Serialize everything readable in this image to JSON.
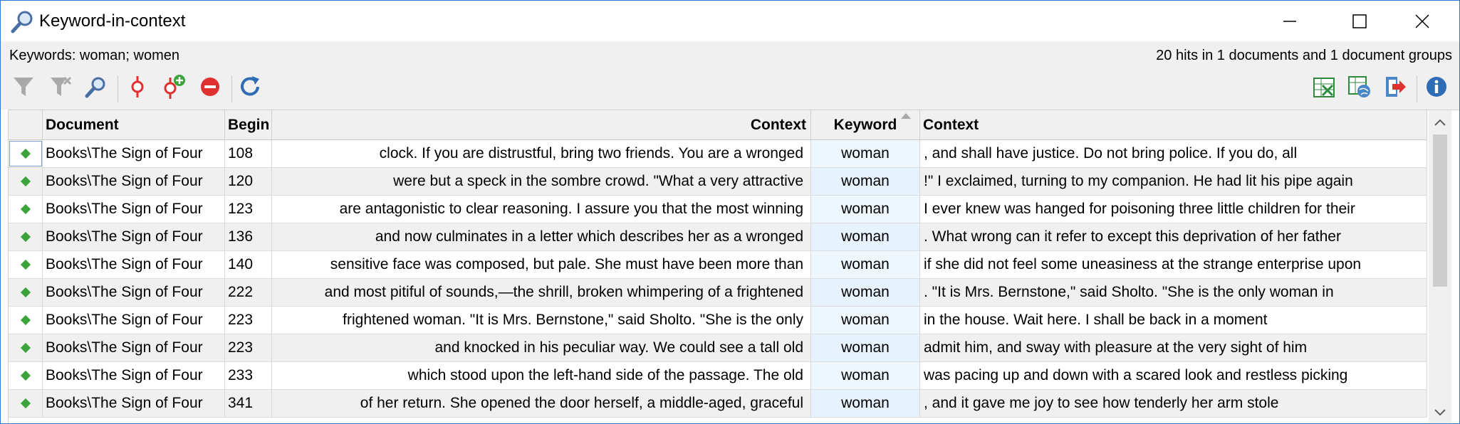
{
  "window": {
    "title": "Keyword-in-context",
    "icon": "magnifier-icon"
  },
  "info": {
    "keywords": "Keywords: woman; women",
    "hits": "20 hits in 1 documents and 1 document groups"
  },
  "toolbar": {
    "left_icons": [
      "filter-icon",
      "clear-filter-icon",
      "search-icon",
      "code-icon",
      "add-code-icon",
      "remove-code-icon",
      "refresh-icon"
    ],
    "right_icons": [
      "excel-export-icon",
      "web-export-icon",
      "export-icon",
      "info-icon"
    ]
  },
  "colors": {
    "accent": "#2b79d6",
    "indicator": "#3aa33a",
    "keyword_bg": "#e6f2fd",
    "code_red": "#e03030"
  },
  "table": {
    "headers": {
      "document": "Document",
      "begin": "Begin",
      "context_left": "Context",
      "keyword": "Keyword",
      "context_right": "Context"
    },
    "sort": {
      "column": "Keyword",
      "direction": "ascending"
    },
    "rows": [
      {
        "document": "Books\\The Sign of Four",
        "begin": "108",
        "left": "clock. If you are distrustful, bring two friends. You are a wronged",
        "keyword": "woman",
        "right": ", and shall have justice. Do not bring police. If you do, all"
      },
      {
        "document": "Books\\The Sign of Four",
        "begin": "120",
        "left": "were but a speck in the sombre crowd.  \"What a very attractive",
        "keyword": "woman",
        "right": "!\" I exclaimed, turning to my companion.  He had lit his pipe again"
      },
      {
        "document": "Books\\The Sign of Four",
        "begin": "123",
        "left": "are antagonistic to clear reasoning. I assure you that the most winning",
        "keyword": "woman",
        "right": " I ever knew was hanged for poisoning three little children for their"
      },
      {
        "document": "Books\\The Sign of Four",
        "begin": "136",
        "left": "and now culminates in a letter which describes her as a wronged",
        "keyword": "woman",
        "right": ". What wrong can it refer to except this deprivation of her father"
      },
      {
        "document": "Books\\The Sign of Four",
        "begin": "140",
        "left": "sensitive face was composed, but pale. She must have been more than",
        "keyword": "woman",
        "right": " if she did not feel some uneasiness at the strange enterprise upon"
      },
      {
        "document": "Books\\The Sign of Four",
        "begin": "222",
        "left": "and most pitiful of sounds,—the shrill, broken whimpering of a frightened",
        "keyword": "woman",
        "right": ".  \"It is Mrs. Bernstone,\" said Sholto. \"She is the only woman in"
      },
      {
        "document": "Books\\The Sign of Four",
        "begin": "223",
        "left": "frightened woman.  \"It is Mrs. Bernstone,\" said Sholto. \"She is the only",
        "keyword": "woman",
        "right": " in the house. Wait here. I shall be back in a moment"
      },
      {
        "document": "Books\\The Sign of Four",
        "begin": "223",
        "left": "and knocked in his peculiar way. We could see a tall old",
        "keyword": "woman",
        "right": " admit him, and sway with pleasure at the very sight of him"
      },
      {
        "document": "Books\\The Sign of Four",
        "begin": "233",
        "left": "which stood upon the left-hand side of the passage. The old",
        "keyword": "woman",
        "right": " was pacing up and down with a scared look and restless picking"
      },
      {
        "document": "Books\\The Sign of Four",
        "begin": "341",
        "left": "of her return. She opened the door herself, a middle-aged, graceful",
        "keyword": "woman",
        "right": ", and it gave me joy to see how tenderly her arm stole"
      }
    ]
  }
}
